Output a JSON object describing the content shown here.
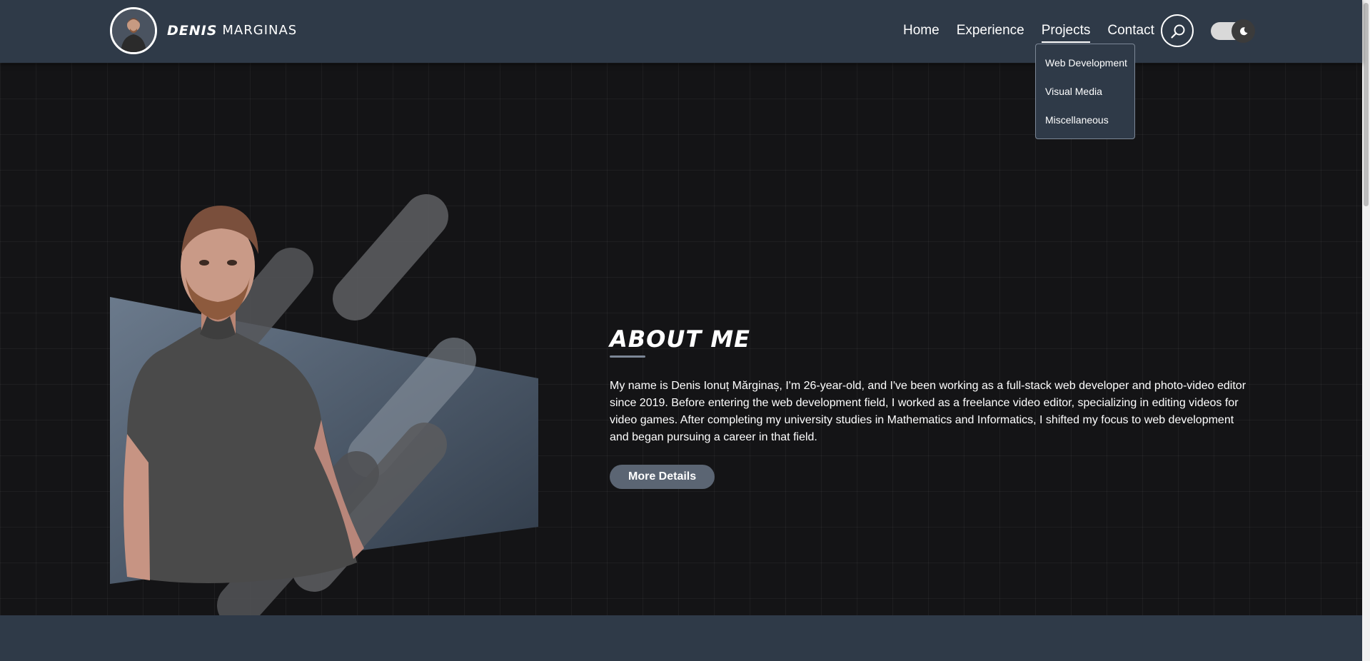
{
  "header": {
    "brand_first": "Denis",
    "brand_last": "Marginas",
    "nav": [
      {
        "label": "Home"
      },
      {
        "label": "Experience"
      },
      {
        "label": "Projects"
      },
      {
        "label": "Contact"
      }
    ],
    "active_nav": "Projects",
    "search_icon": "search-icon",
    "theme_toggle": {
      "state": "dark",
      "icon": "moon-icon"
    }
  },
  "projects_dropdown": {
    "items": [
      {
        "label": "Web Development"
      },
      {
        "label": "Visual Media"
      },
      {
        "label": "Miscellaneous"
      }
    ]
  },
  "about": {
    "title": "About Me",
    "text": "My name is Denis Ionuț Mărginaș, I'm 26-year-old, and I've been working as a full-stack web developer and photo-video editor since 2019. Before entering the web development field, I worked as a freelance video editor, specializing in editing videos for video games. After completing my university studies in Mathematics and Informatics, I shifted my focus to web development and began pursuing a career in that field.",
    "button_label": "More Details"
  },
  "colors": {
    "header_bg": "#2f3a48",
    "page_bg": "#141416",
    "button_bg": "#5b6573",
    "accent_gray": "#7c8796"
  }
}
